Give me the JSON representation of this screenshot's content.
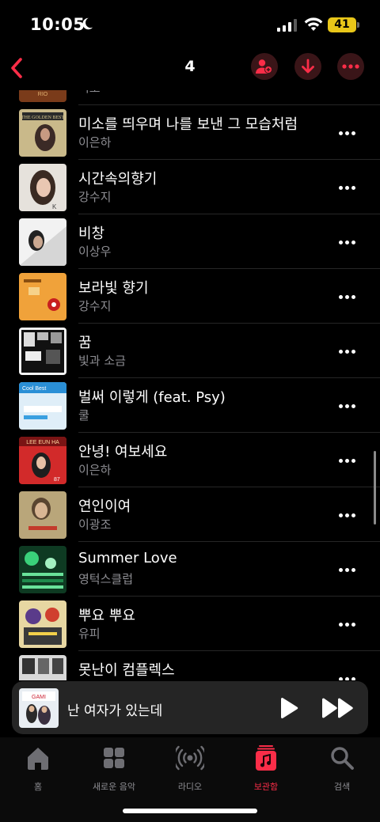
{
  "status": {
    "time": "10:05",
    "battery": "41"
  },
  "nav": {
    "title": "4"
  },
  "songs": [
    {
      "title": "",
      "artist": "리오"
    },
    {
      "title": "미소를 띄우며 나를 보낸 그 모습처럼",
      "artist": "이은하"
    },
    {
      "title": "시간속의향기",
      "artist": "강수지"
    },
    {
      "title": "비창",
      "artist": "이상우"
    },
    {
      "title": "보라빛 향기",
      "artist": "강수지"
    },
    {
      "title": "꿈",
      "artist": "빛과 소금"
    },
    {
      "title": "벌써 이렇게 (feat. Psy)",
      "artist": "쿨"
    },
    {
      "title": "안녕! 여보세요",
      "artist": "이은하"
    },
    {
      "title": "연인이여",
      "artist": "이광조"
    },
    {
      "title": "Summer Love",
      "artist": "영턱스클럽"
    },
    {
      "title": "뿌요 뿌요",
      "artist": "유피"
    },
    {
      "title": "못난이 컴플렉스",
      "artist": ""
    }
  ],
  "now_playing": {
    "title": "난 여자가 있는데"
  },
  "tabs": [
    {
      "label": "홈",
      "icon": "home-icon"
    },
    {
      "label": "새로운 음악",
      "icon": "grid-icon"
    },
    {
      "label": "라디오",
      "icon": "radio-icon"
    },
    {
      "label": "보관함",
      "icon": "library-icon"
    },
    {
      "label": "검색",
      "icon": "search-icon"
    }
  ],
  "colors": {
    "accent": "#fa2d48",
    "secondary_text": "#8e8e93",
    "battery": "#e8c619"
  }
}
